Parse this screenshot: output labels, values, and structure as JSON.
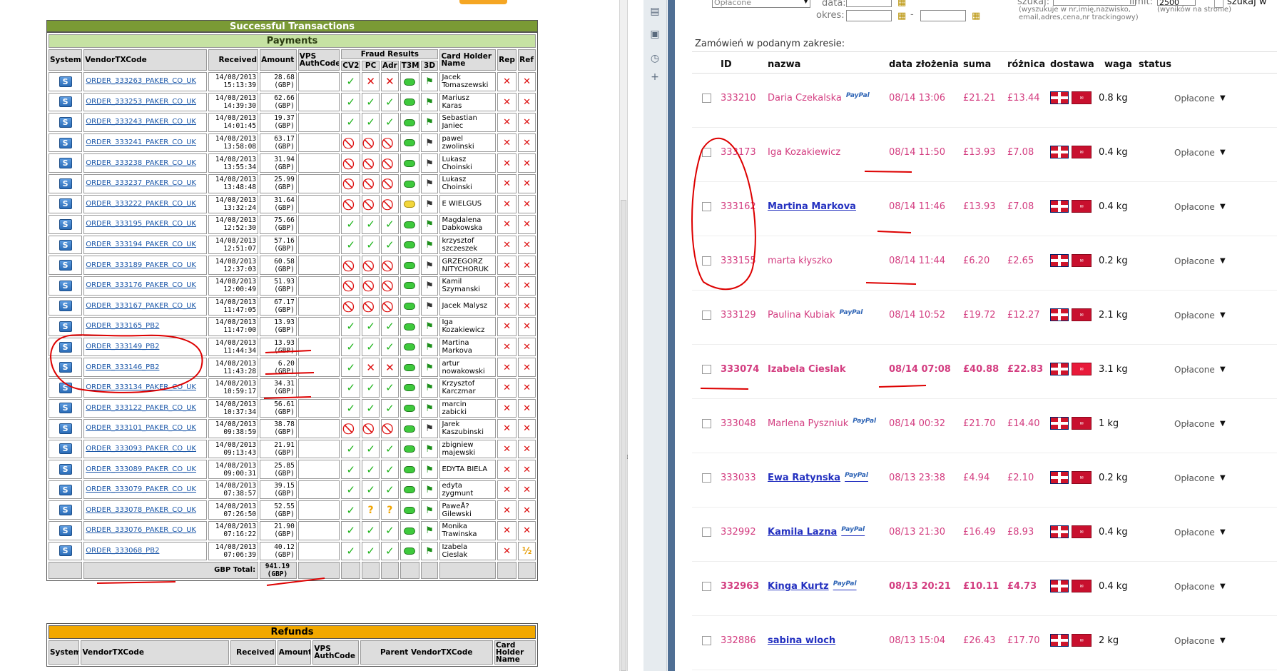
{
  "successful": {
    "title": "Successful Transactions",
    "payments_title": "Payments",
    "headers": {
      "system": "System",
      "vendortx": "VendorTXCode",
      "received": "Received",
      "amount": "Amount",
      "vps": "VPS AuthCode",
      "fraud": "Fraud Results",
      "cv2": "CV2",
      "pc": "PC",
      "adr": "Adr",
      "t3m": "T3M",
      "d3": "3D",
      "cardholder": "Card Holder Name",
      "rep": "Rep",
      "ref": "Ref"
    },
    "rows": [
      {
        "code": "ORDER_333263_PAKER_CO_UK",
        "date": "14/08/2013",
        "time": "15:13:39",
        "amount": "28.68",
        "cur": "(GBP)",
        "cv2": "ok",
        "pc": "bad",
        "adr": "bad",
        "t3m": "g",
        "d3": "g",
        "name1": "Jacek",
        "name2": "Tomaszewski",
        "ref": "x"
      },
      {
        "code": "ORDER_333253_PAKER_CO_UK",
        "date": "14/08/2013",
        "time": "14:39:30",
        "amount": "62.66",
        "cur": "(GBP)",
        "cv2": "ok",
        "pc": "ok",
        "adr": "ok",
        "t3m": "g",
        "d3": "g",
        "name1": "Mariusz",
        "name2": "Karas",
        "ref": "x"
      },
      {
        "code": "ORDER_333243_PAKER_CO_UK",
        "date": "14/08/2013",
        "time": "14:01:45",
        "amount": "19.37",
        "cur": "(GBP)",
        "cv2": "ok",
        "pc": "ok",
        "adr": "ok",
        "t3m": "g",
        "d3": "g",
        "name1": "Sebastian",
        "name2": "Janiec",
        "ref": "x"
      },
      {
        "code": "ORDER_333241_PAKER_CO_UK",
        "date": "14/08/2013",
        "time": "13:58:08",
        "amount": "63.17",
        "cur": "(GBP)",
        "cv2": "no",
        "pc": "no",
        "adr": "no",
        "t3m": "g",
        "d3": "w",
        "name1": "pawel",
        "name2": "zwolinski",
        "ref": "x"
      },
      {
        "code": "ORDER_333238_PAKER_CO_UK",
        "date": "14/08/2013",
        "time": "13:55:34",
        "amount": "31.94",
        "cur": "(GBP)",
        "cv2": "no",
        "pc": "no",
        "adr": "no",
        "t3m": "g",
        "d3": "w",
        "name1": "Lukasz",
        "name2": "Choinski",
        "ref": "x"
      },
      {
        "code": "ORDER_333237_PAKER_CO_UK",
        "date": "14/08/2013",
        "time": "13:48:48",
        "amount": "25.99",
        "cur": "(GBP)",
        "cv2": "no",
        "pc": "no",
        "adr": "no",
        "t3m": "g",
        "d3": "w",
        "name1": "Lukasz",
        "name2": "Choinski",
        "ref": "x"
      },
      {
        "code": "ORDER_333222_PAKER_CO_UK",
        "date": "14/08/2013",
        "time": "13:32:24",
        "amount": "31.64",
        "cur": "(GBP)",
        "cv2": "no",
        "pc": "no",
        "adr": "no",
        "t3m": "y",
        "d3": "w",
        "name1": "E WIELGUS",
        "name2": "",
        "ref": "x"
      },
      {
        "code": "ORDER_333195_PAKER_CO_UK",
        "date": "14/08/2013",
        "time": "12:52:30",
        "amount": "75.66",
        "cur": "(GBP)",
        "cv2": "ok",
        "pc": "ok",
        "adr": "ok",
        "t3m": "g",
        "d3": "g",
        "name1": "Magdalena",
        "name2": "Dabkowska",
        "ref": "x"
      },
      {
        "code": "ORDER_333194_PAKER_CO_UK",
        "date": "14/08/2013",
        "time": "12:51:07",
        "amount": "57.16",
        "cur": "(GBP)",
        "cv2": "ok",
        "pc": "ok",
        "adr": "ok",
        "t3m": "g",
        "d3": "g",
        "name1": "krzysztof",
        "name2": "szczeszek",
        "ref": "x"
      },
      {
        "code": "ORDER_333189_PAKER_CO_UK",
        "date": "14/08/2013",
        "time": "12:37:03",
        "amount": "60.58",
        "cur": "(GBP)",
        "cv2": "no",
        "pc": "no",
        "adr": "no",
        "t3m": "g",
        "d3": "w",
        "name1": "GRZEGORZ",
        "name2": "NITYCHORUK",
        "ref": "x"
      },
      {
        "code": "ORDER_333176_PAKER_CO_UK",
        "date": "14/08/2013",
        "time": "12:00:49",
        "amount": "51.93",
        "cur": "(GBP)",
        "cv2": "no",
        "pc": "no",
        "adr": "no",
        "t3m": "g",
        "d3": "w",
        "name1": "Kamil",
        "name2": "Szymanski",
        "ref": "x"
      },
      {
        "code": "ORDER_333167_PAKER_CO_UK",
        "date": "14/08/2013",
        "time": "11:47:05",
        "amount": "67.17",
        "cur": "(GBP)",
        "cv2": "no",
        "pc": "no",
        "adr": "no",
        "t3m": "g",
        "d3": "w",
        "name1": "Jacek Malysz",
        "name2": "",
        "ref": "x"
      },
      {
        "code": "ORDER_333165_PB2",
        "date": "14/08/2013",
        "time": "11:47:00",
        "amount": "13.93",
        "cur": "(GBP)",
        "cv2": "ok",
        "pc": "ok",
        "adr": "ok",
        "t3m": "g",
        "d3": "g",
        "name1": "Iga",
        "name2": "Kozakiewicz",
        "ref": "x"
      },
      {
        "code": "ORDER_333149_PB2",
        "date": "14/08/2013",
        "time": "11:44:34",
        "amount": "13.93",
        "cur": "(GBP)",
        "cv2": "ok",
        "pc": "ok",
        "adr": "ok",
        "t3m": "g",
        "d3": "g",
        "name1": "Martina",
        "name2": "Markova",
        "ref": "x"
      },
      {
        "code": "ORDER_333146_PB2",
        "date": "14/08/2013",
        "time": "11:43:28",
        "amount": "6.20",
        "cur": "(GBP)",
        "cv2": "ok",
        "pc": "bad",
        "adr": "bad",
        "t3m": "g",
        "d3": "g",
        "name1": "artur",
        "name2": "nowakowski",
        "ref": "x"
      },
      {
        "code": "ORDER_333134_PAKER_CO_UK",
        "date": "14/08/2013",
        "time": "10:59:17",
        "amount": "34.31",
        "cur": "(GBP)",
        "cv2": "ok",
        "pc": "ok",
        "adr": "ok",
        "t3m": "g",
        "d3": "g",
        "name1": "Krzysztof",
        "name2": "Karczmar",
        "ref": "x"
      },
      {
        "code": "ORDER_333122_PAKER_CO_UK",
        "date": "14/08/2013",
        "time": "10:37:34",
        "amount": "56.61",
        "cur": "(GBP)",
        "cv2": "ok",
        "pc": "ok",
        "adr": "ok",
        "t3m": "g",
        "d3": "g",
        "name1": "marcin",
        "name2": "zabicki",
        "ref": "x"
      },
      {
        "code": "ORDER_333101_PAKER_CO_UK",
        "date": "14/08/2013",
        "time": "09:38:59",
        "amount": "38.78",
        "cur": "(GBP)",
        "cv2": "no",
        "pc": "no",
        "adr": "no",
        "t3m": "g",
        "d3": "w",
        "name1": "Jarek",
        "name2": "Kaszubinski",
        "ref": "x"
      },
      {
        "code": "ORDER_333093_PAKER_CO_UK",
        "date": "14/08/2013",
        "time": "09:13:43",
        "amount": "21.91",
        "cur": "(GBP)",
        "cv2": "ok",
        "pc": "ok",
        "adr": "ok",
        "t3m": "g",
        "d3": "g",
        "name1": "zbigniew",
        "name2": "majewski",
        "ref": "x"
      },
      {
        "code": "ORDER_333089_PAKER_CO_UK",
        "date": "14/08/2013",
        "time": "09:00:31",
        "amount": "25.85",
        "cur": "(GBP)",
        "cv2": "ok",
        "pc": "ok",
        "adr": "ok",
        "t3m": "g",
        "d3": "g",
        "name1": "EDYTA BIELA",
        "name2": "",
        "ref": "x"
      },
      {
        "code": "ORDER_333079_PAKER_CO_UK",
        "date": "14/08/2013",
        "time": "07:38:57",
        "amount": "39.15",
        "cur": "(GBP)",
        "cv2": "ok",
        "pc": "ok",
        "adr": "ok",
        "t3m": "g",
        "d3": "g",
        "name1": "edyta",
        "name2": "zygmunt",
        "ref": "x"
      },
      {
        "code": "ORDER_333078_PAKER_CO_UK",
        "date": "14/08/2013",
        "time": "07:26:50",
        "amount": "52.55",
        "cur": "(GBP)",
        "cv2": "ok",
        "pc": "q",
        "adr": "q",
        "t3m": "g",
        "d3": "g",
        "name1": "PaweÅ?",
        "name2": "Gilewski",
        "ref": "x"
      },
      {
        "code": "ORDER_333076_PAKER_CO_UK",
        "date": "14/08/2013",
        "time": "07:16:22",
        "amount": "21.90",
        "cur": "(GBP)",
        "cv2": "ok",
        "pc": "ok",
        "adr": "ok",
        "t3m": "g",
        "d3": "g",
        "name1": "Monika",
        "name2": "Trawinska",
        "ref": "x"
      },
      {
        "code": "ORDER_333068_PB2",
        "date": "14/08/2013",
        "time": "07:06:39",
        "amount": "40.12",
        "cur": "(GBP)",
        "cv2": "ok",
        "pc": "ok",
        "adr": "ok",
        "t3m": "g",
        "d3": "g",
        "name1": "Izabela",
        "name2": "Cieslak",
        "ref": "half"
      }
    ],
    "total_label": "GBP Total:",
    "total_amount": "941.19",
    "total_cur": "(GBP)"
  },
  "refunds": {
    "title": "Refunds",
    "headers": {
      "system": "System",
      "vendortx": "VendorTXCode",
      "received": "Received",
      "amount": "Amount",
      "vps": "VPS AuthCode",
      "parent": "Parent VendorTXCode",
      "cardholder": "Card Holder Name"
    }
  },
  "filters": {
    "status_value": "Opłacone",
    "data_label": "data:",
    "okres_label": "okres:",
    "okres_dash": "-",
    "szukaj_label": "szukaj:",
    "szukaj_hint": "(wyszukuje w nr,imię,nazwisko, email,adres,cena,nr trackingowy)",
    "limit_label": "limit:",
    "limit_value": "2500",
    "limit_hint": "(wyników na stronie)",
    "szukaj_check_label": "szukaj w"
  },
  "orders": {
    "section_title": "Zamówień w podanym zakresie:",
    "headers": {
      "id": "ID",
      "name": "nazwa",
      "date": "data złożenia",
      "sum": "suma",
      "diff": "różnica",
      "delivery": "dostawa",
      "weight": "waga",
      "status": "status"
    },
    "paypal_label": "PayPal",
    "rows": [
      {
        "id": "333210",
        "name": "Daria Czekalska",
        "paypal": true,
        "date": "08/14 13:06",
        "sum": "£21.21",
        "diff": "£13.44",
        "weight": "0.8 kg",
        "status": "Opłacone",
        "style": "normal"
      },
      {
        "id": "333173",
        "name": "Iga Kozakiewicz",
        "paypal": false,
        "date": "08/14 11:50",
        "sum": "£13.93",
        "diff": "£7.08",
        "weight": "0.4 kg",
        "status": "Opłacone",
        "style": "normal"
      },
      {
        "id": "333162",
        "name": "Martina Markova",
        "paypal": false,
        "date": "08/14 11:46",
        "sum": "£13.93",
        "diff": "£7.08",
        "weight": "0.4 kg",
        "status": "Opłacone",
        "style": "link"
      },
      {
        "id": "333155",
        "name": "marta kłyszko",
        "paypal": false,
        "date": "08/14 11:44",
        "sum": "£6.20",
        "diff": "£2.65",
        "weight": "0.2 kg",
        "status": "Opłacone",
        "style": "normal"
      },
      {
        "id": "333129",
        "name": "Paulina Kubiak",
        "paypal": true,
        "date": "08/14 10:52",
        "sum": "£19.72",
        "diff": "£12.27",
        "weight": "2.1 kg",
        "status": "Opłacone",
        "style": "normal"
      },
      {
        "id": "333074",
        "name": "Izabela Cieslak",
        "paypal": false,
        "date": "08/14 07:08",
        "sum": "£40.88",
        "diff": "£22.83",
        "weight": "3.1 kg",
        "status": "Opłacone",
        "style": "bold"
      },
      {
        "id": "333048",
        "name": "Marlena Pyszniuk",
        "paypal": true,
        "date": "08/14 00:32",
        "sum": "£21.70",
        "diff": "£14.40",
        "weight": "1 kg",
        "status": "Opłacone",
        "style": "normal"
      },
      {
        "id": "333033",
        "name": "Ewa Ratynska",
        "paypal": true,
        "date": "08/13 23:38",
        "sum": "£4.94",
        "diff": "£2.10",
        "weight": "0.2 kg",
        "status": "Opłacone",
        "style": "link"
      },
      {
        "id": "332992",
        "name": "Kamila Lazna",
        "paypal": true,
        "date": "08/13 21:30",
        "sum": "£16.49",
        "diff": "£8.93",
        "weight": "0.4 kg",
        "status": "Opłacone",
        "style": "link"
      },
      {
        "id": "332963",
        "name": "Kinga Kurtz",
        "paypal": true,
        "date": "08/13 20:21",
        "sum": "£10.11",
        "diff": "£4.73",
        "weight": "0.4 kg",
        "status": "Opłacone",
        "style": "linkbold"
      },
      {
        "id": "332886",
        "name": "sabina wloch",
        "paypal": false,
        "date": "08/13 15:04",
        "sum": "£26.43",
        "diff": "£17.70",
        "weight": "2 kg",
        "status": "Opłacone",
        "style": "link"
      }
    ]
  },
  "colors": {
    "green_header": "#7a9a35",
    "payments_header": "#c6e2a3",
    "refunds_header": "#f2a800",
    "order_pink": "#d33d80",
    "link_blue": "#2431c0",
    "annotation_red": "#dd0000"
  }
}
